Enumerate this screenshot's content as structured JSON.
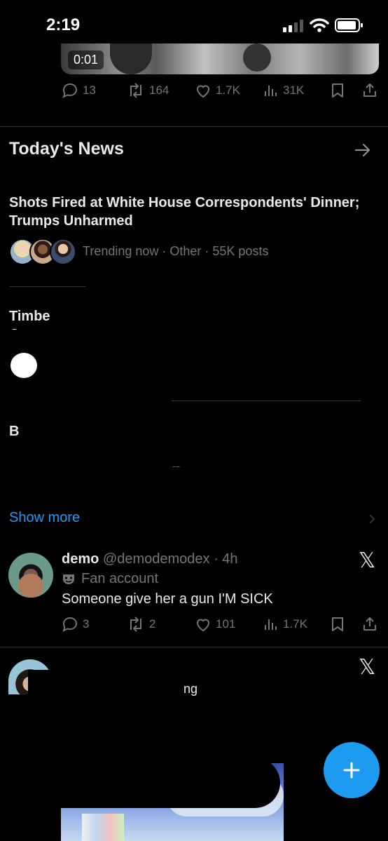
{
  "status_bar": {
    "time": "2:19"
  },
  "prev_tweet": {
    "video_duration": "0:01",
    "actions": {
      "replies": "13",
      "reposts": "164",
      "likes": "1.7K",
      "views": "31K"
    }
  },
  "news": {
    "heading": "Today's News",
    "items": [
      {
        "headline": "Shots Fired at White House Correspondents' Dinner; Trumps Unharmed",
        "meta": "Trending now · Other · 55K posts"
      },
      {
        "headline_visible": "Timbe",
        "headline_line2_visible": "C"
      },
      {
        "headline_visible": "B",
        "meta_visible": "ts"
      }
    ],
    "show_more_label": "Show more"
  },
  "tweet": {
    "display_name": "demo",
    "handle_time": "@demodemodex · 4h",
    "account_label": "Fan account",
    "text": "Someone give her a gun I'M SICK",
    "actions": {
      "replies": "3",
      "reposts": "2",
      "likes": "101",
      "views": "1.7K"
    }
  },
  "next_tweet": {
    "visible_text": "ng"
  },
  "icons": {
    "reply": "reply-icon",
    "repost": "repost-icon",
    "like": "heart-icon",
    "views": "views-icon",
    "bookmark": "bookmark-icon",
    "share": "share-icon",
    "arrow": "arrow-right-icon",
    "chevron": "chevron-right-icon",
    "x_logo": "x-logo-icon",
    "mask": "mask-icon",
    "compose": "plus-icon"
  },
  "colors": {
    "accent": "#1d9bf0",
    "muted": "#71767b",
    "text": "#e7e9ea",
    "background": "#000000"
  }
}
